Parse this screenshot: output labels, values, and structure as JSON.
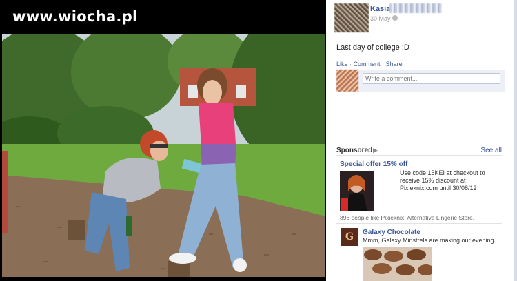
{
  "watermark": "www.wiocha.pl",
  "post": {
    "owner_name": "Kasia",
    "date": "30 May",
    "caption": "Last day of college :D",
    "actions": [
      "Like",
      "Comment",
      "Share"
    ],
    "comment_placeholder": "Write a comment..."
  },
  "sponsored": {
    "label": "Sponsored",
    "see_all": "See all",
    "ads": [
      {
        "title": "Special offer 15% off",
        "text": "Use code 15KEI at checkout to receive 15% discount at Pixieknix.com until 30/08/12",
        "social": "896 people like Pixieknix: Alternative Lingerie Store."
      },
      {
        "title": "Galaxy Chocolate",
        "text": "Mmm, Galaxy Minstrels are making our evening...",
        "logo_letter": "G"
      }
    ]
  },
  "colors": {
    "link": "#3b5998",
    "panel_bg": "#ffffff",
    "viewer_bg": "#000000"
  }
}
